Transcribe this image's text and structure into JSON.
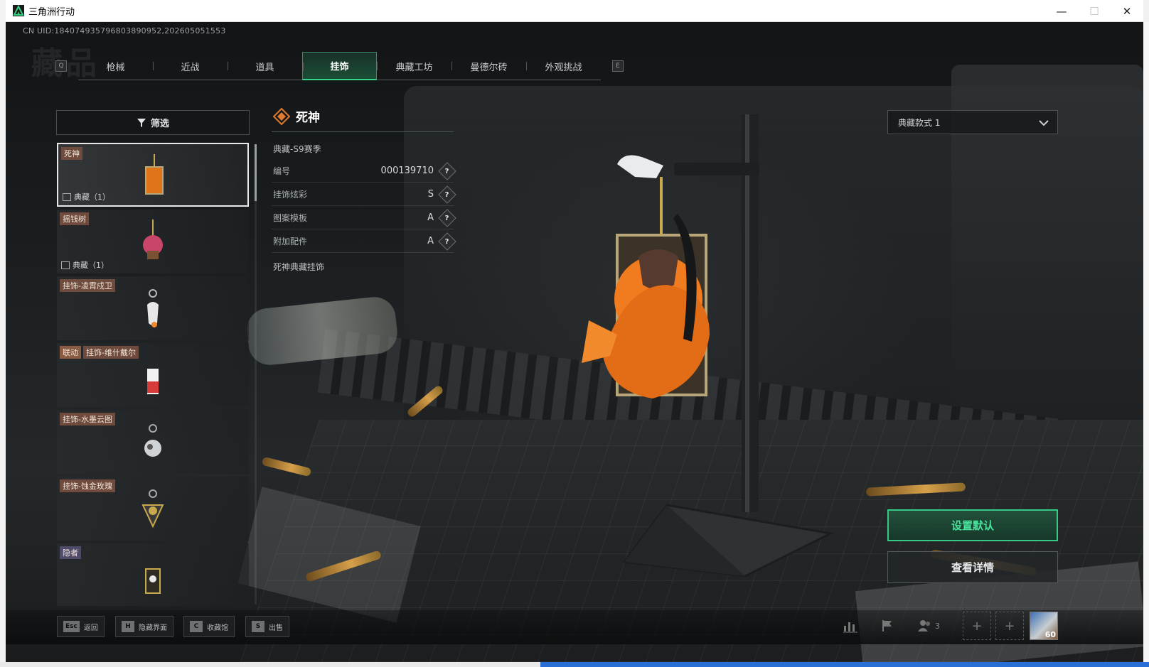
{
  "window": {
    "title": "三角洲行动",
    "controls": {
      "minimize": "—",
      "maximize": "☐",
      "close": "✕"
    }
  },
  "header": {
    "uid": "CN UID:18407493579680389095​2,202605051553",
    "watermark": "藏品"
  },
  "tabs": {
    "prev_key": "Q",
    "next_key": "E",
    "items": [
      {
        "label": "枪械",
        "active": false
      },
      {
        "label": "近战",
        "active": false
      },
      {
        "label": "道具",
        "active": false
      },
      {
        "label": "挂饰",
        "active": true
      },
      {
        "label": "典藏工坊",
        "active": false
      },
      {
        "label": "曼德尔砖",
        "active": false
      },
      {
        "label": "外观挑战",
        "active": false
      }
    ]
  },
  "filter": {
    "label": "筛选"
  },
  "list": {
    "items": [
      {
        "tags": [
          "死神"
        ],
        "footer": "典藏（1）",
        "selected": true
      },
      {
        "tags": [
          "摇钱树"
        ],
        "footer": "典藏（1）",
        "selected": false
      },
      {
        "tags": [
          "挂饰-凌霄戍卫"
        ],
        "footer": "",
        "selected": false
      },
      {
        "tags": [
          "联动",
          "挂饰-维什戴尔"
        ],
        "footer": "",
        "selected": false
      },
      {
        "tags": [
          "挂饰-水墨云图"
        ],
        "footer": "",
        "selected": false
      },
      {
        "tags": [
          "挂饰-蚀金玫瑰"
        ],
        "footer": "",
        "selected": false
      },
      {
        "tags": [
          "隐者"
        ],
        "footer": "",
        "selected": false
      }
    ]
  },
  "detail": {
    "name": "死神",
    "season": "典藏-S9赛季",
    "attributes": [
      {
        "label": "编号",
        "value": "000139710"
      },
      {
        "label": "挂饰炫彩",
        "value": "S"
      },
      {
        "label": "图案模板",
        "value": "A"
      },
      {
        "label": "附加配件",
        "value": "A"
      }
    ],
    "help_glyph": "?",
    "description": "死神典藏挂饰"
  },
  "style_select": {
    "value": "典藏款式 1"
  },
  "actions": {
    "set_default": "设置默认",
    "view_details": "查看详情"
  },
  "bottom_hints": [
    {
      "key": "Esc",
      "label": "返回"
    },
    {
      "key": "H",
      "label": "隐藏界面"
    },
    {
      "key": "C",
      "label": "收藏馆"
    },
    {
      "key": "S",
      "label": "出售"
    }
  ],
  "tray": {
    "friends_count": "3",
    "add_glyph": "+",
    "avatar_level": "60"
  },
  "colors": {
    "accent_green": "#37c986",
    "tag_brown": "#6e4b3c",
    "title_orange": "#e07a2c"
  }
}
